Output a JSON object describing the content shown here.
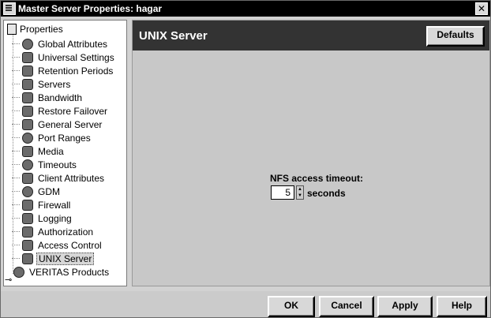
{
  "window": {
    "title": "Master Server Properties: hagar",
    "close_label": "✕"
  },
  "tree": {
    "root_label": "Properties",
    "items": [
      {
        "label": "Global Attributes",
        "icon": "globe-icon"
      },
      {
        "label": "Universal Settings",
        "icon": "universal-settings-icon"
      },
      {
        "label": "Retention Periods",
        "icon": "retention-icon"
      },
      {
        "label": "Servers",
        "icon": "server-icon"
      },
      {
        "label": "Bandwidth",
        "icon": "bandwidth-icon"
      },
      {
        "label": "Restore Failover",
        "icon": "failover-icon"
      },
      {
        "label": "General Server",
        "icon": "general-server-icon"
      },
      {
        "label": "Port Ranges",
        "icon": "port-ranges-icon"
      },
      {
        "label": "Media",
        "icon": "media-icon"
      },
      {
        "label": "Timeouts",
        "icon": "clock-icon"
      },
      {
        "label": "Client Attributes",
        "icon": "client-attributes-icon"
      },
      {
        "label": "GDM",
        "icon": "gdm-icon"
      },
      {
        "label": "Firewall",
        "icon": "firewall-icon"
      },
      {
        "label": "Logging",
        "icon": "logging-icon"
      },
      {
        "label": "Authorization",
        "icon": "authorization-icon"
      },
      {
        "label": "Access Control",
        "icon": "access-control-icon"
      },
      {
        "label": "UNIX Server",
        "icon": "unix-server-icon",
        "selected": true
      },
      {
        "label": "VERITAS Products",
        "icon": "veritas-icon"
      }
    ]
  },
  "header": {
    "title": "UNIX Server",
    "defaults_label": "Defaults"
  },
  "form": {
    "nfs_label": "NFS access timeout:",
    "nfs_value": "5",
    "nfs_unit": "seconds",
    "spinner_up": "▲",
    "spinner_down": "▼"
  },
  "buttons": {
    "ok": "OK",
    "cancel": "Cancel",
    "apply": "Apply",
    "help": "Help"
  }
}
